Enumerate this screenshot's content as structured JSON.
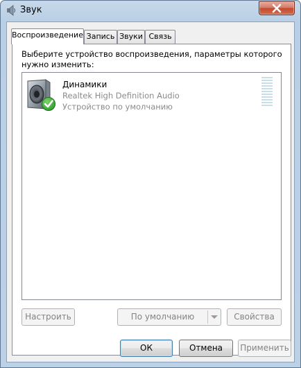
{
  "window": {
    "title": "Звук"
  },
  "tabs": [
    {
      "label": "Воспроизведение",
      "active": true
    },
    {
      "label": "Запись",
      "active": false
    },
    {
      "label": "Звуки",
      "active": false
    },
    {
      "label": "Связь",
      "active": false
    }
  ],
  "instruction": "Выберите устройство воспроизведения, параметры которого нужно изменить:",
  "devices": [
    {
      "name": "Динамики",
      "driver": "Realtek High Definition Audio",
      "status": "Устройство по умолчанию",
      "icon": "speaker-icon",
      "badge": "default-check-icon",
      "level": 0
    }
  ],
  "panel_buttons": {
    "configure": "Настроить",
    "set_default": "По умолчанию",
    "properties": "Свойства"
  },
  "dialog_buttons": {
    "ok": "ОК",
    "cancel": "Отмена",
    "apply": "Применить"
  },
  "colors": {
    "accent": "#3c7fb1",
    "check": "#2e9e2e",
    "close": "#c24a30"
  }
}
